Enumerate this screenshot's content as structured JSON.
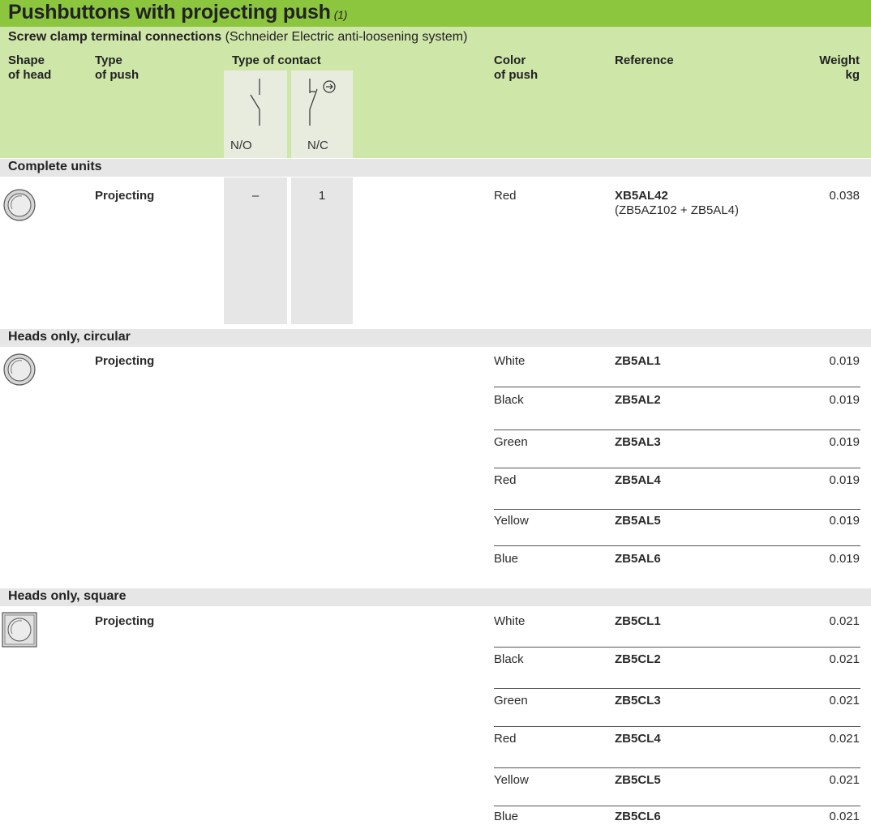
{
  "title": "Pushbuttons with projecting push",
  "title_note": "(1)",
  "subtitle_bold": "Screw clamp terminal connections",
  "subtitle_rest": " (Schneider Electric anti-loosening system)",
  "headers": {
    "shape_1": "Shape",
    "shape_2": "of head",
    "type_1": "Type",
    "type_2": "of push",
    "contact": "Type of contact",
    "no": "N/O",
    "nc": "N/C",
    "color_1": "Color",
    "color_2": "of push",
    "reference": "Reference",
    "weight_1": "Weight",
    "weight_2": "kg"
  },
  "complete_units": {
    "title": "Complete units",
    "push_type": "Projecting",
    "no": "–",
    "nc": "1",
    "color": "Red",
    "reference": "XB5AL42",
    "reference_detail": "(ZB5AZ102 + ZB5AL4)",
    "weight": "0.038"
  },
  "heads_circular": {
    "title": "Heads only, circular",
    "push_type": "Projecting",
    "rows": [
      {
        "color": "White",
        "reference": "ZB5AL1",
        "weight": "0.019"
      },
      {
        "color": "Black",
        "reference": "ZB5AL2",
        "weight": "0.019"
      },
      {
        "color": "Green",
        "reference": "ZB5AL3",
        "weight": "0.019"
      },
      {
        "color": "Red",
        "reference": "ZB5AL4",
        "weight": "0.019"
      },
      {
        "color": "Yellow",
        "reference": "ZB5AL5",
        "weight": "0.019"
      },
      {
        "color": "Blue",
        "reference": "ZB5AL6",
        "weight": "0.019"
      }
    ]
  },
  "heads_square": {
    "title": "Heads only, square",
    "push_type": "Projecting",
    "rows": [
      {
        "color": "White",
        "reference": "ZB5CL1",
        "weight": "0.021"
      },
      {
        "color": "Black",
        "reference": "ZB5CL2",
        "weight": "0.021"
      },
      {
        "color": "Green",
        "reference": "ZB5CL3",
        "weight": "0.021"
      },
      {
        "color": "Red",
        "reference": "ZB5CL4",
        "weight": "0.021"
      },
      {
        "color": "Yellow",
        "reference": "ZB5CL5",
        "weight": "0.021"
      },
      {
        "color": "Blue",
        "reference": "ZB5CL6",
        "weight": "0.021"
      }
    ]
  },
  "colors": {
    "title_bar": "#8cc63f",
    "header_bg": "#cfe6a9",
    "section_bg": "#e6e6e6"
  },
  "icons": {
    "circular_head": "circular-pushbutton-icon",
    "square_head": "square-pushbutton-icon",
    "no_contact": "normally-open-contact-symbol",
    "nc_contact": "normally-closed-contact-symbol"
  }
}
